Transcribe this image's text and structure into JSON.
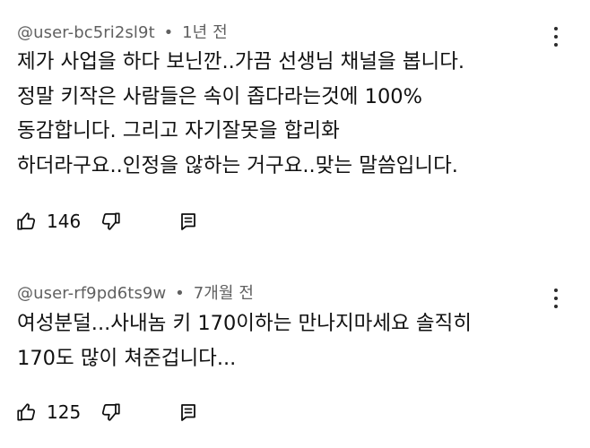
{
  "comments": [
    {
      "author": "@user-bc5ri2sl9t",
      "separator": "•",
      "time": "1년 전",
      "lines": [
        "제가 사업을 하다 보닌깐..가끔 선생님 채널을 봅니다.",
        "정말 키작은 사람들은 속이 좁다라는것에 100%",
        "동감합니다. 그리고 자기잘못을 합리화",
        "하더라구요..인정을 않하는 거구요..맞는 말씀입니다."
      ],
      "likes": "146"
    },
    {
      "author": "@user-rf9pd6ts9w",
      "separator": "•",
      "time": "7개월 전",
      "lines": [
        "여성분덜...사내놈 키 170이하는 만나지마세요 솔직히",
        "170도 많이 쳐준겁니다..."
      ],
      "likes": "125"
    }
  ],
  "icons": {
    "like": "thumbs-up-icon",
    "dislike": "thumbs-down-icon",
    "reply": "reply-icon",
    "more": "more-vert-icon"
  }
}
